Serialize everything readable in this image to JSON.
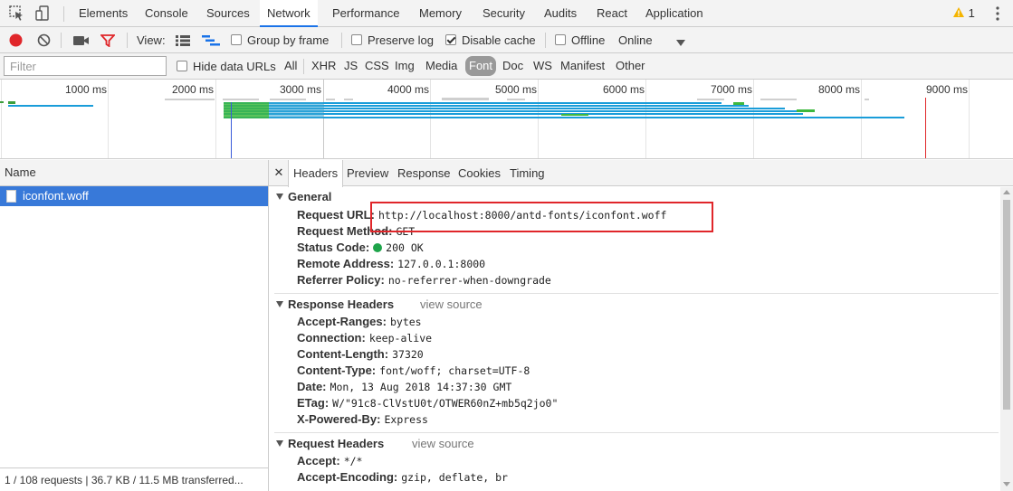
{
  "main_tabs": [
    "Elements",
    "Console",
    "Sources",
    "Network",
    "Performance",
    "Memory",
    "Security",
    "Audits",
    "React",
    "Application"
  ],
  "active_main_tab": "Network",
  "warning_count": "1",
  "toolbar": {
    "view_label": "View:",
    "group_by_frame": "Group by frame",
    "preserve_log": "Preserve log",
    "disable_cache": "Disable cache",
    "offline": "Offline",
    "online": "Online"
  },
  "filter": {
    "placeholder": "Filter",
    "hide_data_urls": "Hide data URLs",
    "types": [
      "All",
      "XHR",
      "JS",
      "CSS",
      "Img",
      "Media",
      "Font",
      "Doc",
      "WS",
      "Manifest",
      "Other"
    ],
    "active_type": "Font"
  },
  "overview": {
    "ticks": [
      "1000 ms",
      "2000 ms",
      "3000 ms",
      "4000 ms",
      "5000 ms",
      "6000 ms",
      "7000 ms",
      "8000 ms",
      "9000 ms"
    ]
  },
  "requests": {
    "column_header": "Name",
    "items": [
      {
        "name": "iconfont.woff",
        "selected": true
      }
    ],
    "status": "1 / 108 requests | 36.7 KB / 11.5 MB transferred..."
  },
  "detail": {
    "close_symbol": "✕",
    "tabs": [
      "Headers",
      "Preview",
      "Response",
      "Cookies",
      "Timing"
    ],
    "active_tab": "Headers",
    "view_source": "view source",
    "general": {
      "title": "General",
      "rows": [
        {
          "key": "Request URL:",
          "value": "http://localhost:8000/antd-fonts/iconfont.woff"
        },
        {
          "key": "Request Method:",
          "value": "GET"
        },
        {
          "key": "Status Code:",
          "value": "200 OK"
        },
        {
          "key": "Remote Address:",
          "value": "127.0.0.1:8000"
        },
        {
          "key": "Referrer Policy:",
          "value": "no-referrer-when-downgrade"
        }
      ]
    },
    "response_headers": {
      "title": "Response Headers",
      "rows": [
        {
          "key": "Accept-Ranges:",
          "value": "bytes"
        },
        {
          "key": "Connection:",
          "value": "keep-alive"
        },
        {
          "key": "Content-Length:",
          "value": "37320"
        },
        {
          "key": "Content-Type:",
          "value": "font/woff; charset=UTF-8"
        },
        {
          "key": "Date:",
          "value": "Mon, 13 Aug 2018 14:37:30 GMT"
        },
        {
          "key": "ETag:",
          "value": "W/\"91c8-ClVstU0t/OTWER60nZ+mb5q2jo0\""
        },
        {
          "key": "X-Powered-By:",
          "value": "Express"
        }
      ]
    },
    "request_headers": {
      "title": "Request Headers",
      "rows": [
        {
          "key": "Accept:",
          "value": "*/*"
        },
        {
          "key": "Accept-Encoding:",
          "value": "gzip, deflate, br"
        }
      ]
    }
  },
  "colors": {
    "accent_tab": "#1a73e8",
    "record": "#e0262a",
    "selected_row": "#3879d9",
    "status_ok": "#1ea44a",
    "highlight": "#e0262a"
  }
}
